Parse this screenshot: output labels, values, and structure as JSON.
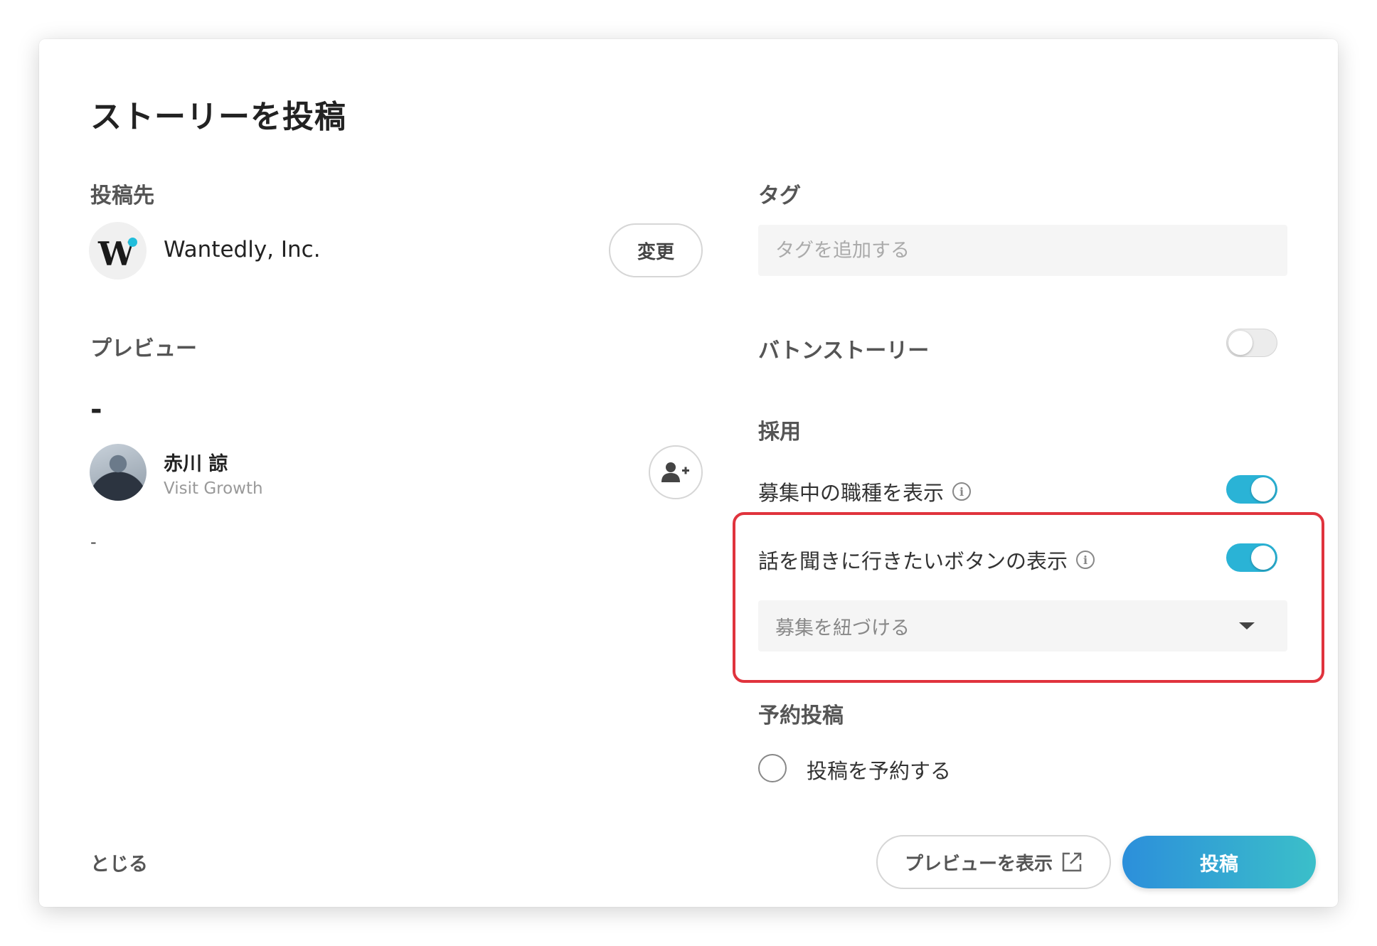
{
  "modal": {
    "title": "ストーリーを投稿"
  },
  "destination": {
    "label": "投稿先",
    "company_name": "Wantedly, Inc.",
    "change_label": "変更"
  },
  "preview": {
    "label": "プレビュー",
    "title": "-",
    "author_name": "赤川 諒",
    "author_role": "Visit Growth",
    "body": "-"
  },
  "tags": {
    "label": "タグ",
    "placeholder": "タグを追加する"
  },
  "baton": {
    "label": "バトンストーリー",
    "enabled": false
  },
  "recruit": {
    "label": "採用",
    "show_jobs_label": "募集中の職種を表示",
    "show_jobs_enabled": true,
    "visit_button_label": "話を聞きに行きたいボタンの表示",
    "visit_button_enabled": true,
    "link_select_value": "募集を紐づける"
  },
  "schedule": {
    "label": "予約投稿",
    "option_label": "投稿を予約する"
  },
  "footer": {
    "close_label": "とじる",
    "preview_button_label": "プレビューを表示",
    "submit_label": "投稿"
  },
  "colors": {
    "accent": "#2ab3d6",
    "highlight": "#e0333d",
    "submit_gradient_start": "#2c8fdb",
    "submit_gradient_end": "#3bbfc9"
  },
  "icons": {
    "info": "info-icon",
    "add_user": "add-user-icon",
    "external_link": "external-link-icon",
    "caret": "chevron-down-icon"
  }
}
